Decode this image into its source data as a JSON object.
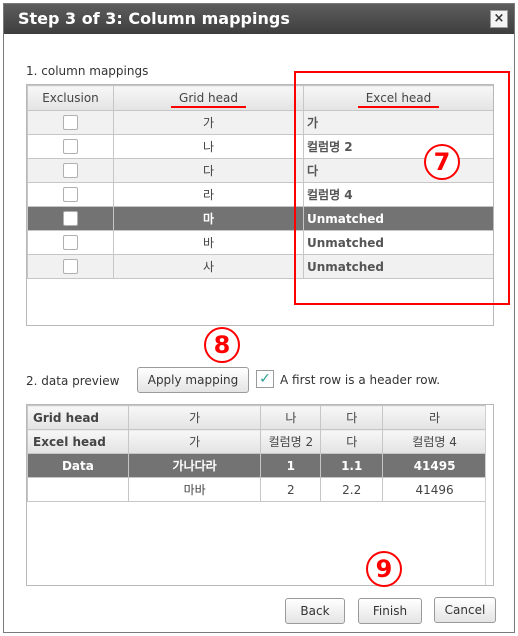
{
  "dialog": {
    "title": "Step 3 of 3: Column mappings",
    "close_label": "×"
  },
  "mapping": {
    "section_label": "1. column mappings",
    "columns": {
      "exclusion": "Exclusion",
      "grid_head": "Grid head",
      "excel_head": "Excel head"
    },
    "rows": [
      {
        "grid": "가",
        "excel": "가",
        "selected": false
      },
      {
        "grid": "나",
        "excel": "컬럼명 2",
        "selected": false
      },
      {
        "grid": "다",
        "excel": "다",
        "selected": false
      },
      {
        "grid": "라",
        "excel": "컬럼명 4",
        "selected": false
      },
      {
        "grid": "마",
        "excel": "Unmatched",
        "selected": true
      },
      {
        "grid": "바",
        "excel": "Unmatched",
        "selected": false
      },
      {
        "grid": "사",
        "excel": "Unmatched",
        "selected": false
      }
    ]
  },
  "preview": {
    "section_label": "2. data preview",
    "apply_button": "Apply mapping",
    "header_checkbox_label": "A first row is a header row.",
    "header_checked": true,
    "rows": {
      "grid_head": {
        "label": "Grid head",
        "cells": [
          "가",
          "나",
          "다",
          "라"
        ]
      },
      "excel_head": {
        "label": "Excel head",
        "cells": [
          "가",
          "컬럼명 2",
          "다",
          "컬럼명 4"
        ]
      },
      "data": [
        {
          "label": "Data",
          "cells": [
            "가나다라",
            "1",
            "1.1",
            "41495"
          ]
        },
        {
          "label": "",
          "cells": [
            "마바",
            "2",
            "2.2",
            "41496"
          ]
        }
      ]
    }
  },
  "annotations": {
    "seven": "7",
    "eight": "8",
    "nine": "9"
  },
  "footer": {
    "back": "Back",
    "finish": "Finish",
    "cancel": "Cancel"
  },
  "colors": {
    "annotation": "#ff0000",
    "selected_row": "#737373",
    "check": "#2a9d8f"
  }
}
